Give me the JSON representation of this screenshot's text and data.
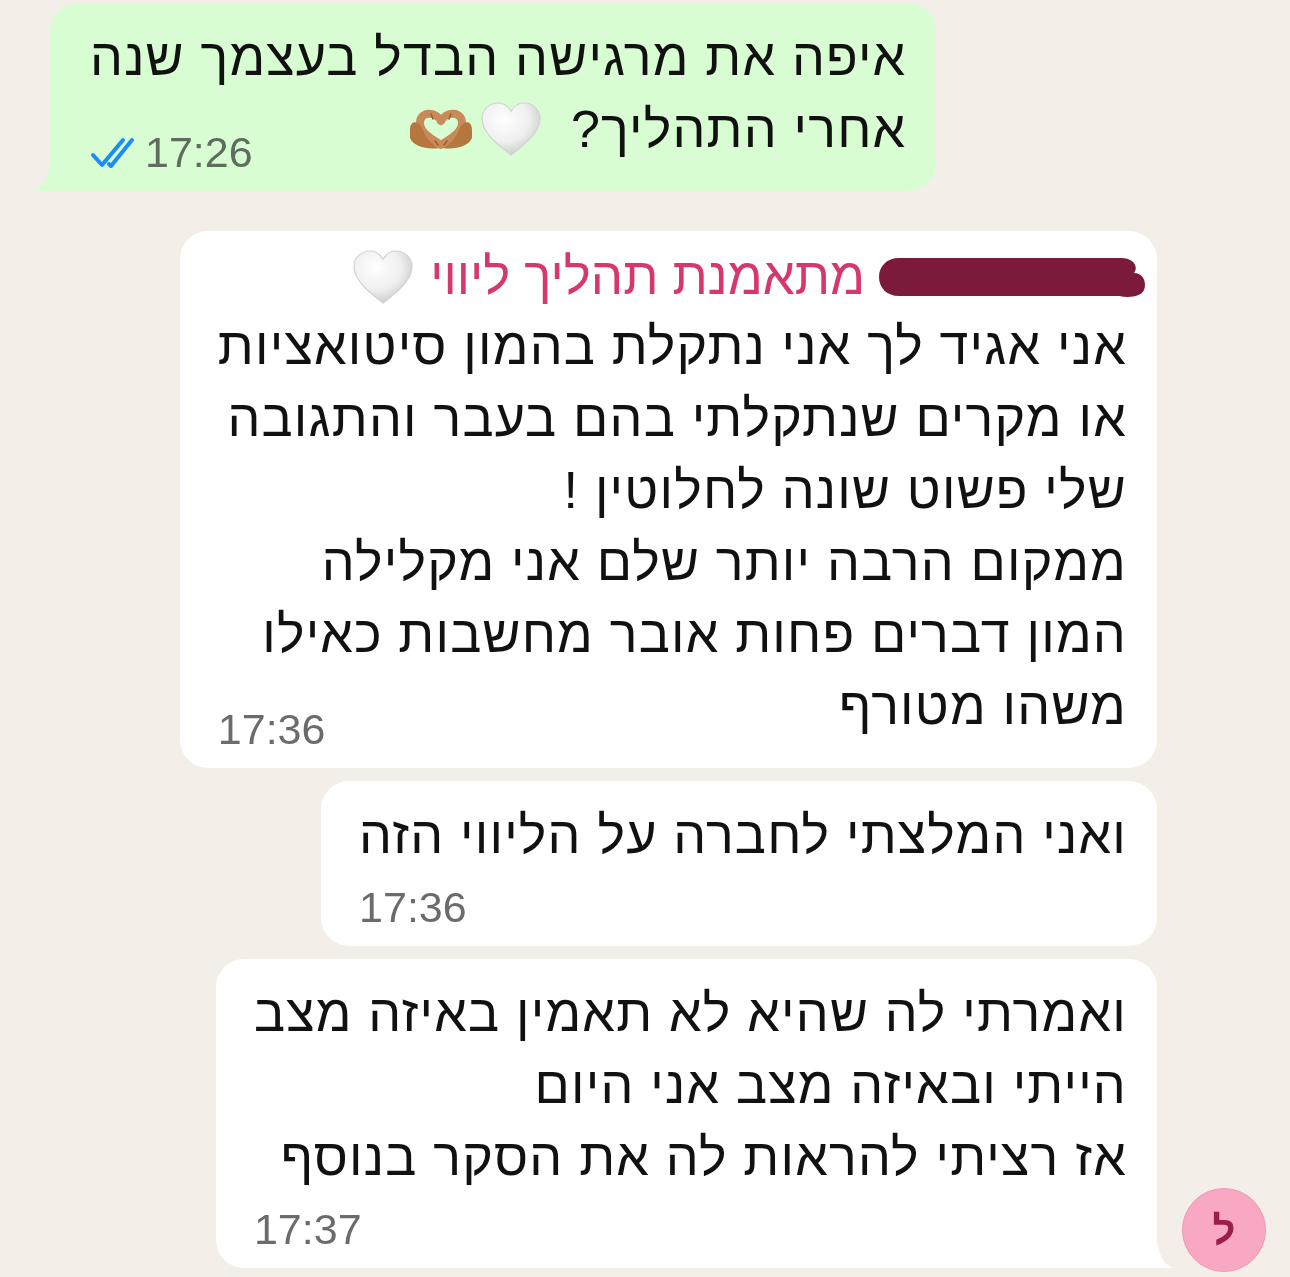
{
  "groups": [
    {
      "kind": "outgoing",
      "messages": [
        {
          "lines": [
            "איפה את מרגישה הבדל בעצמך שנה",
            "אחרי התהליך?"
          ],
          "emojis": [
            {
              "kind": "white_heart"
            },
            {
              "kind": "heart_hands"
            }
          ],
          "time": "17:26",
          "read": true
        }
      ]
    },
    {
      "kind": "incoming",
      "sender": {
        "name": "מתאמנת תהליך ליווי",
        "emojis": [
          {
            "kind": "white_heart"
          }
        ],
        "redacted": true
      },
      "avatar": {
        "initial": "ל"
      },
      "messages": [
        {
          "lines": [
            "אני אגיד לך אני נתקלת בהמון סיטואציות",
            "או מקרים שנתקלתי בהם בעבר והתגובה",
            "שלי פשוט שונה לחלוטין !",
            "ממקום הרבה יותר שלם אני מקלילה",
            "המון דברים פחות אובר מחשבות כאילו",
            "משהו מטורף"
          ],
          "time": "17:36"
        },
        {
          "lines": [
            "ואני המלצתי לחברה על הליווי הזה"
          ],
          "time": "17:36"
        },
        {
          "lines": [
            "ואמרתי לה שהיא לא תאמין באיזה מצב",
            "הייתי ובאיזה מצב אני היום",
            "אז רציתי להראות לה את הסקר בנוסף"
          ],
          "time": "17:37"
        }
      ]
    }
  ]
}
